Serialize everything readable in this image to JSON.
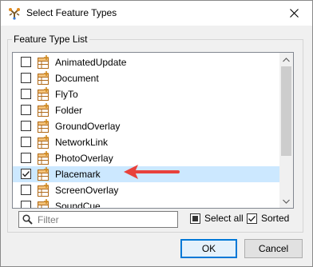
{
  "dialog": {
    "title": "Select Feature Types",
    "group_label": "Feature Type List",
    "close_icon": "close-icon"
  },
  "list": {
    "items": [
      {
        "label": "AnimatedUpdate",
        "checked": false,
        "selected": false
      },
      {
        "label": "Document",
        "checked": false,
        "selected": false
      },
      {
        "label": "FlyTo",
        "checked": false,
        "selected": false
      },
      {
        "label": "Folder",
        "checked": false,
        "selected": false
      },
      {
        "label": "GroundOverlay",
        "checked": false,
        "selected": false
      },
      {
        "label": "NetworkLink",
        "checked": false,
        "selected": false
      },
      {
        "label": "PhotoOverlay",
        "checked": false,
        "selected": false
      },
      {
        "label": "Placemark",
        "checked": true,
        "selected": true
      },
      {
        "label": "ScreenOverlay",
        "checked": false,
        "selected": false
      },
      {
        "label": "SoundCue",
        "checked": false,
        "selected": false
      }
    ]
  },
  "filter": {
    "placeholder": "Filter",
    "value": ""
  },
  "options": {
    "select_all_label": "Select all",
    "sorted_label": "Sorted",
    "select_all_state": "indeterminate",
    "sorted_checked": true
  },
  "buttons": {
    "ok_label": "OK",
    "cancel_label": "Cancel"
  },
  "colors": {
    "accent": "#0078d7",
    "selection": "#cce8ff",
    "annotation_arrow": "#e8413b"
  }
}
